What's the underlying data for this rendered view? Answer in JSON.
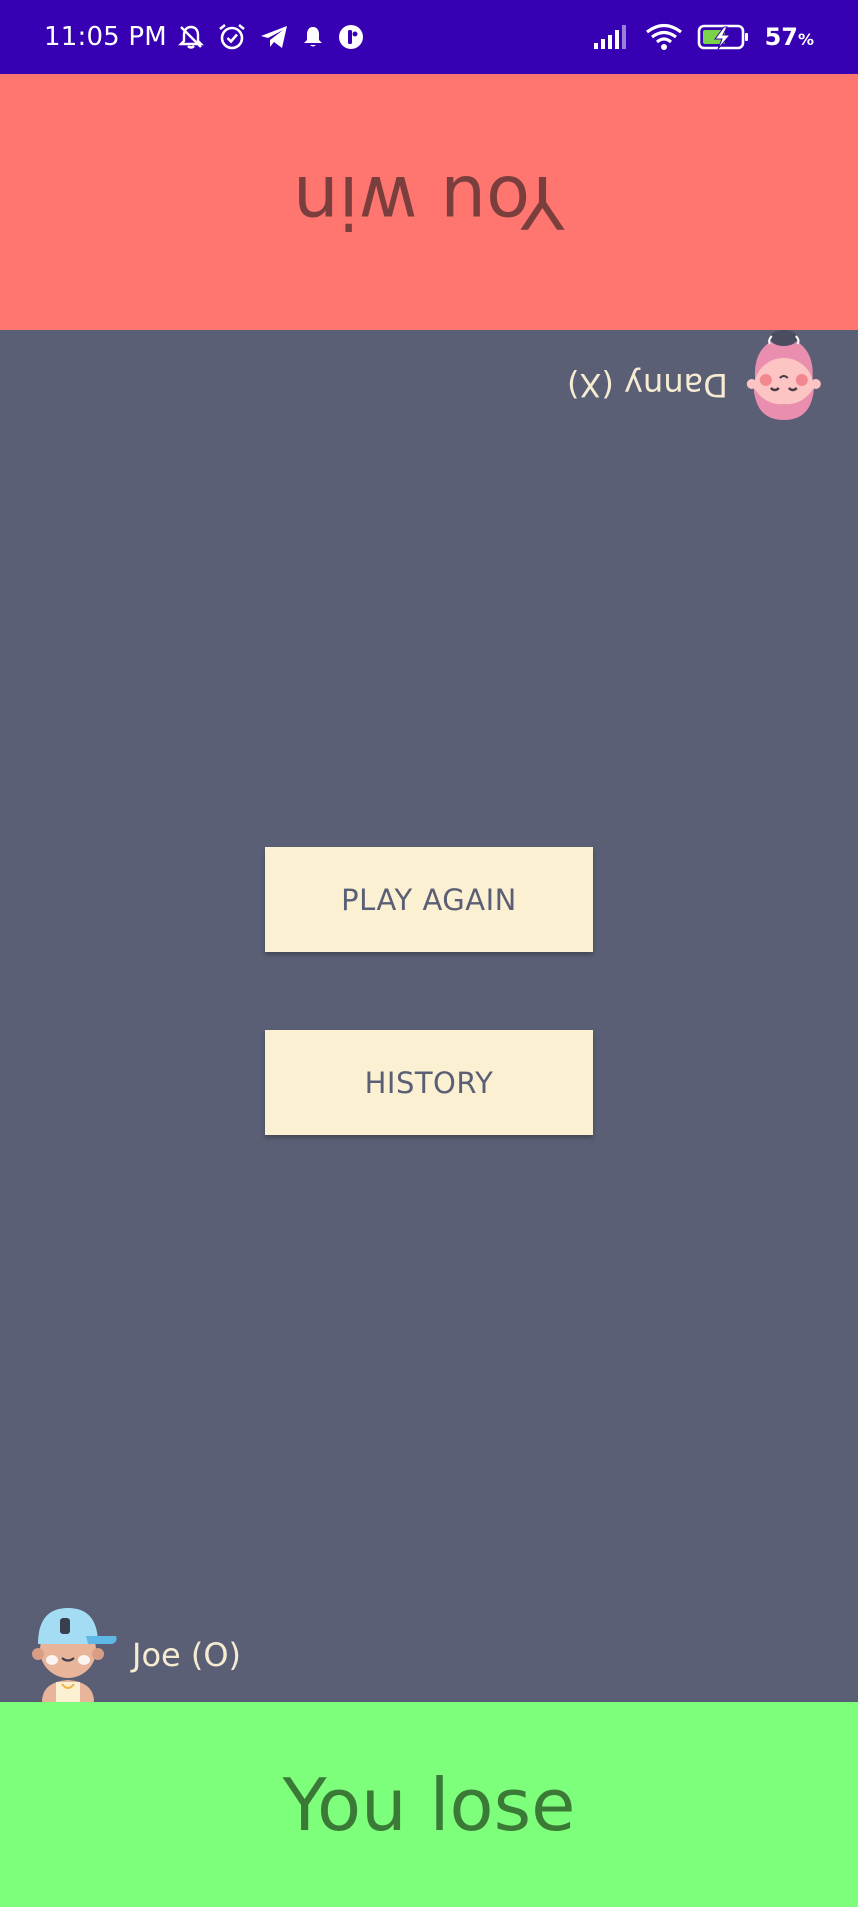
{
  "status_bar": {
    "time": "11:05 PM",
    "battery_percent": "57",
    "battery_unit": "%",
    "icons": [
      "bell-off-icon",
      "alarm-icon",
      "telegram-icon",
      "notification-bell-icon",
      "app-status-icon",
      "signal-icon",
      "wifi-icon",
      "battery-charging-icon"
    ],
    "background_color": "#3700b3"
  },
  "top_banner": {
    "text": "You win",
    "color": "#ff7671"
  },
  "players": {
    "top": {
      "name": "Danny (X)",
      "avatar": "girl-avatar-icon"
    },
    "bottom": {
      "name": "Joe (O)",
      "avatar": "boy-avatar-icon"
    }
  },
  "buttons": {
    "play_again": "PLAY AGAIN",
    "history": "HISTORY"
  },
  "bottom_banner": {
    "text": "You lose",
    "color": "#7eff7c"
  },
  "colors": {
    "game_background": "#5a5f75",
    "button_background": "#fcf0d2"
  }
}
